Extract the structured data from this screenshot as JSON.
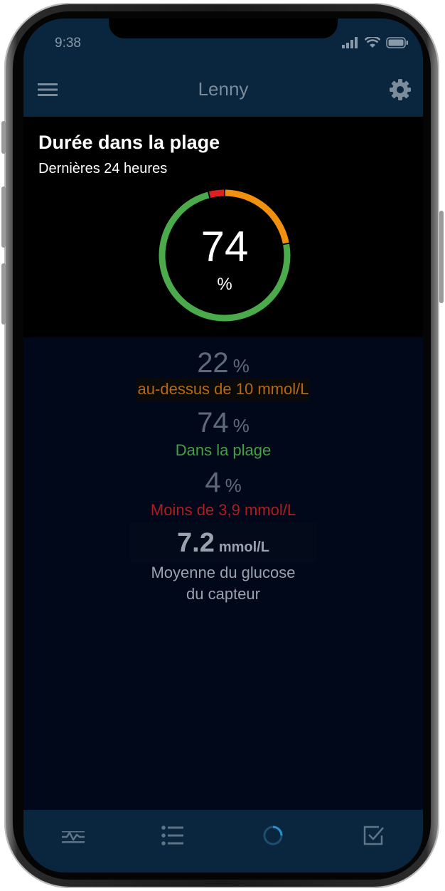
{
  "status_bar": {
    "time": "9:38"
  },
  "header": {
    "title": "Lenny"
  },
  "tir": {
    "title": "Durée dans la plage",
    "subtitle": "Dernières 24 heures",
    "value": "74",
    "unit": "%"
  },
  "stats": {
    "above": {
      "value": "22",
      "unit": "%",
      "label": "au-dessus de 10 mmol/L"
    },
    "in_range": {
      "value": "74",
      "unit": "%",
      "label": "Dans la plage"
    },
    "below": {
      "value": "4",
      "unit": "%",
      "label": "Moins de 3,9 mmol/L"
    },
    "average": {
      "value": "7.2",
      "unit": "mmol/L",
      "label_line1": "Moyenne du glucose",
      "label_line2": "du capteur"
    }
  },
  "chart_data": {
    "type": "pie",
    "categories": [
      "au-dessus de 10 mmol/L",
      "Dans la plage",
      "Moins de 3,9 mmol/L"
    ],
    "values": [
      22,
      74,
      4
    ],
    "colors": [
      "#f0900c",
      "#4bab4b",
      "#e02020"
    ]
  },
  "colors": {
    "above": "#b8680e",
    "in_range": "#45a043",
    "below": "#b01d1d",
    "header_bg": "#0a263e"
  },
  "icons": {
    "menu": "hamburger-menu-icon",
    "settings": "gear-icon",
    "tabs": [
      "glucose-graph-icon",
      "list-icon",
      "spinner-icon",
      "checkbox-icon"
    ]
  }
}
